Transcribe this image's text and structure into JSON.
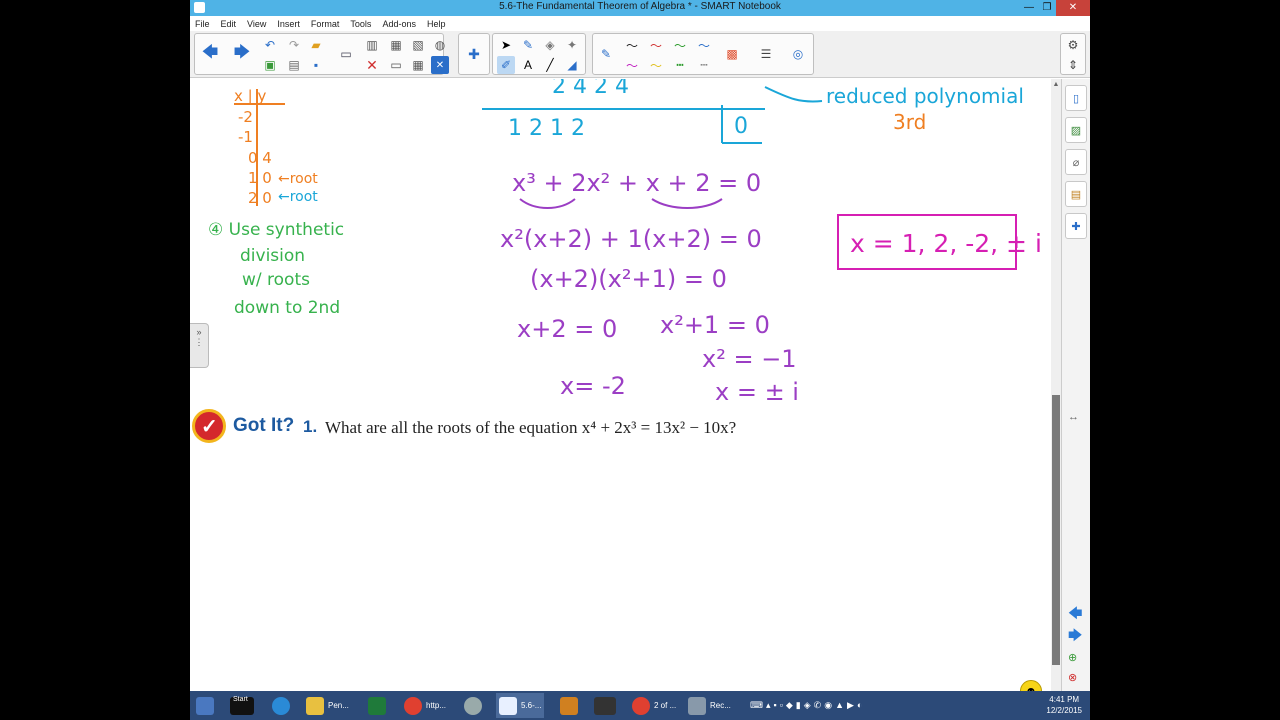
{
  "window": {
    "title": "5.6-The Fundamental Theorem of Algebra * - SMART Notebook",
    "min": "—",
    "max": "❐",
    "close": "✕"
  },
  "menu": [
    "File",
    "Edit",
    "View",
    "Insert",
    "Format",
    "Tools",
    "Add-ons",
    "Help"
  ],
  "page": {
    "gotit": {
      "label": "Got It?",
      "number": "1.",
      "question": "What are all the roots of the equation x⁴ + 2x³ = 13x² − 10x?"
    },
    "left_notes": {
      "table_header": "x | y",
      "rows": [
        "-2",
        "-1",
        "0 4",
        "1 0",
        "2 0"
      ],
      "root1": "←root",
      "root2": "←root",
      "step4_line1": "④ Use synthetic",
      "step4_line2": "division",
      "step4_line3": "w/ roots",
      "step4_line4": "down to 2nd"
    },
    "work": {
      "top_row": "2   4   2   4",
      "bottom_row": "1   2   1   2",
      "remainder": "0",
      "reduced_label": "reduced polynomial",
      "degree": "3rd",
      "line1": "x³ + 2x² + x + 2 = 0",
      "line2": "x²(x+2) + 1(x+2) = 0",
      "line3": "(x+2)(x²+1) = 0",
      "line4a": "x+2 = 0",
      "line4b": "x²+1 = 0",
      "line5": "x² = −1",
      "line6a": "x= -2",
      "line6b": "x = ± i",
      "answer": "x = 1, 2, -2, ± i"
    }
  },
  "taskbar": {
    "start": "Start",
    "items": [
      "Pen...",
      "http...",
      "5.6-...",
      "2 of ...",
      "Rec..."
    ],
    "time": "4:41 PM",
    "date": "12/2/2015"
  },
  "colors": {
    "title_bar": "#4fb3e6",
    "ink_blue": "#1aa6d8",
    "ink_purple": "#9b3ec4",
    "ink_green": "#37b24d",
    "ink_orange": "#ef7f22",
    "ink_magenta": "#d61fb3",
    "taskbar": "#2c4a78"
  }
}
